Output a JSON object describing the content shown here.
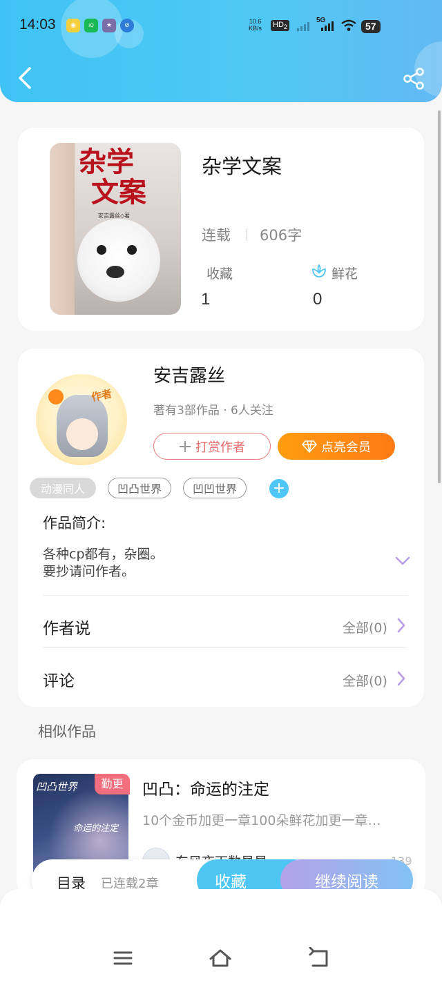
{
  "status_bar": {
    "time": "14:03",
    "net_speed_value": "10.6",
    "net_speed_unit": "KB/s",
    "hd_label": "HD",
    "hd_sub": "2",
    "network": "5G",
    "battery": "57"
  },
  "header": {
    "back_icon": "chevron-left-icon",
    "share_icon": "share-icon",
    "gradient_start": "#3fc3f4",
    "gradient_end": "#62b9f3"
  },
  "book": {
    "title": "杂学文案",
    "cover_title_line1": "杂学",
    "cover_title_line2": "文案",
    "cover_author": "安吉露丝◇著",
    "status": "连载",
    "word_count": "606字",
    "favorites_label": "收藏",
    "favorites_value": "1",
    "flowers_label": "鲜花",
    "flowers_value": "0"
  },
  "author": {
    "name": "安吉露丝",
    "avatar_badge": "作者",
    "meta": "著有3部作品 · 6人关注",
    "tip_button": "打赏作者",
    "vip_button": "点亮会员",
    "tags": [
      "动漫同人",
      "凹凸世界",
      "凹凹世界"
    ],
    "add_tag": "+"
  },
  "intro": {
    "heading": "作品简介:",
    "line1": "各种cp都有，杂圈。",
    "line2": "要抄请问作者。"
  },
  "rows": {
    "author_says_label": "作者说",
    "author_says_all": "全部(0)",
    "comments_label": "评论",
    "comments_all": "全部(0)"
  },
  "similar": {
    "heading": "相似作品",
    "items": [
      {
        "cover_text1": "凹凸世界",
        "cover_text2": "命运的注定",
        "badge": "勤更",
        "title": "凹凸：命运的注定",
        "description": "10个金币加更一章100朵鲜花加更一章…",
        "author": "东风夜下数星星",
        "likes": "139"
      }
    ]
  },
  "actionbar": {
    "catalog": "目录",
    "serialized": "已连载2章",
    "favorite": "收藏",
    "continue": "继续阅读",
    "fav_color": "#4dc6f4"
  },
  "navbar": {
    "icons": [
      "menu-icon",
      "home-icon",
      "return-icon"
    ]
  }
}
